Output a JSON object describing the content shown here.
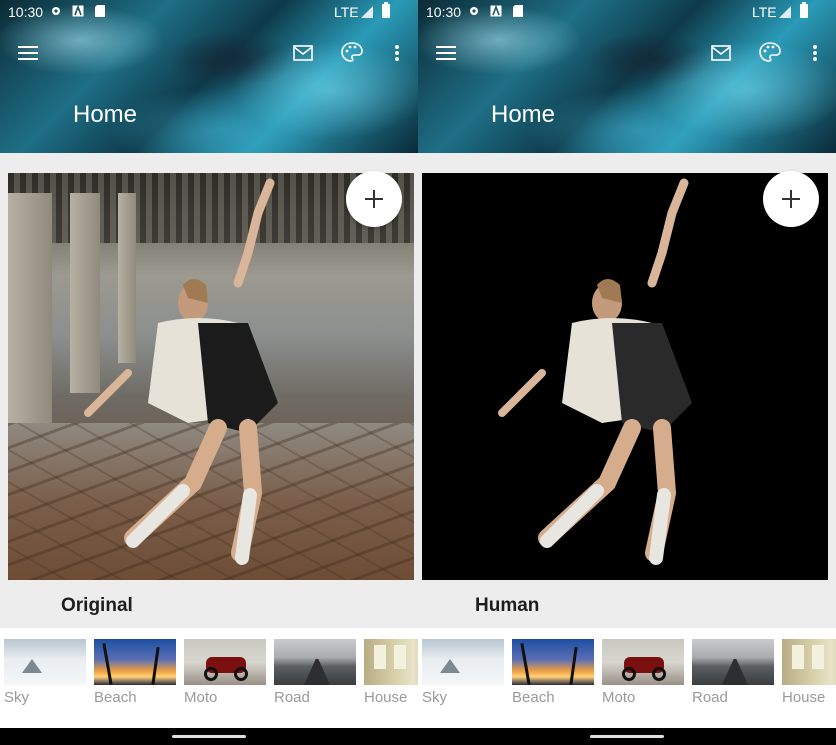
{
  "colors": {
    "accent_fab": "#ffffff",
    "app_bg": "#ededed",
    "strip_bg": "#ffffff",
    "label_gray": "#9a9a9a"
  },
  "panels": [
    {
      "status": {
        "time": "10:30",
        "network": "LTE"
      },
      "title": "Home",
      "icons": [
        "menu-icon",
        "mail-icon",
        "palette-icon",
        "more-vert-icon"
      ],
      "photo_kind": "original",
      "caption": "Original",
      "filters": [
        {
          "label": "Sky"
        },
        {
          "label": "Beach"
        },
        {
          "label": "Moto"
        },
        {
          "label": "Road"
        },
        {
          "label": "House"
        }
      ]
    },
    {
      "status": {
        "time": "10:30",
        "network": "LTE"
      },
      "title": "Home",
      "icons": [
        "menu-icon",
        "mail-icon",
        "palette-icon",
        "more-vert-icon"
      ],
      "photo_kind": "human-cutout",
      "caption": "Human",
      "filters": [
        {
          "label": "Sky"
        },
        {
          "label": "Beach"
        },
        {
          "label": "Moto"
        },
        {
          "label": "Road"
        },
        {
          "label": "House"
        }
      ]
    }
  ]
}
